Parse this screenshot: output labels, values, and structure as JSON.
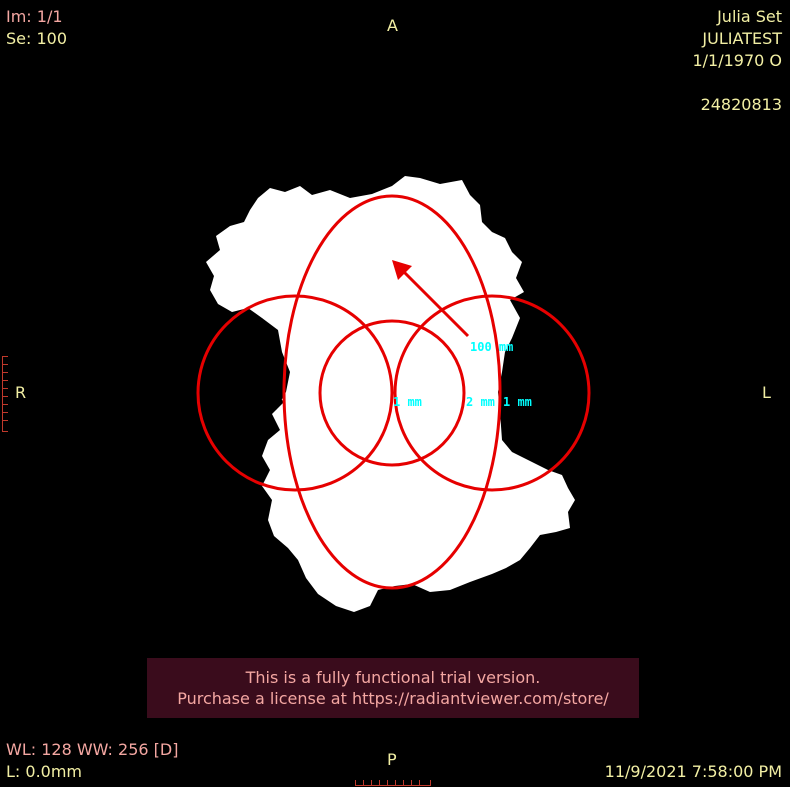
{
  "overlay": {
    "top_left": {
      "image": "Im: 1/1",
      "series": "Se: 100"
    },
    "top_right": {
      "study": "Julia Set",
      "patient_id": "JULIATEST",
      "date": "1/1/1970 O",
      "accession": "24820813"
    },
    "orientation": {
      "top": "A",
      "bottom": "P",
      "left": "R",
      "right": "L"
    },
    "bottom_left": {
      "window": "WL: 128 WW: 256 [D]",
      "location": "L: 0.0mm"
    },
    "bottom_right": {
      "datetime": "11/9/2021 7:58:00 PM"
    }
  },
  "trial_banner": {
    "line1": "This is a fully functional trial version.",
    "line2": "Purchase a license at https://radiantviewer.com/store/"
  },
  "annotations": {
    "arrow_label": "100 mm",
    "circle_center_label": "1 mm",
    "circle_mid_label": "2 mm",
    "circle_right_label": "1 mm"
  },
  "colors": {
    "annotation": "#e60000",
    "measure_text": "#00ffff",
    "overlay_text": "#f2efa4",
    "overlay_info": "#f4a7a2"
  }
}
